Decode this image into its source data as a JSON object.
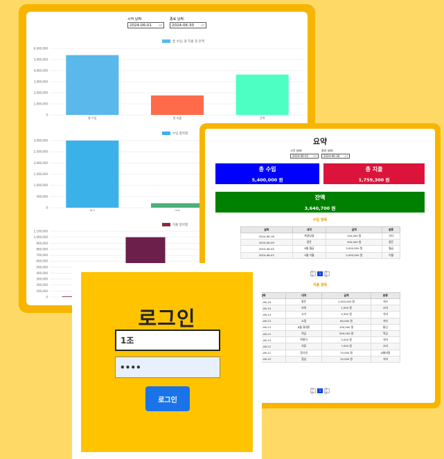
{
  "dashboard": {
    "start_label": "시작 날짜:",
    "end_label": "종료 날짜:",
    "start_date": "2024-06-01",
    "end_date": "2024-06-30",
    "calendar_icon": "calendar-icon"
  },
  "chart_data": [
    {
      "type": "bar",
      "legend": "총 수입, 총 지출 및 잔액",
      "categories": [
        "총 수입",
        "총 지출",
        "잔액"
      ],
      "values": [
        5400000,
        1759300,
        3640700
      ],
      "colors": [
        "#5ab8ea",
        "#ff6b4a",
        "#4dffc3"
      ],
      "y_ticks": [
        "6,000,000",
        "5,000,000",
        "4,000,000",
        "3,000,000",
        "2,000,000",
        "1,000,000",
        "0"
      ],
      "ylim": [
        0,
        6000000
      ],
      "grid": true,
      "legend_position": "top"
    },
    {
      "type": "bar",
      "legend": "수입 항목별",
      "categories": [
        "월급",
        "이자",
        "용돈"
      ],
      "values": [
        3000000,
        200000,
        600000
      ],
      "colors": [
        "#3bb1ea",
        "#4caf7a",
        "#1f6fd8"
      ],
      "y_ticks": [
        "3,000,000",
        "2,500,000",
        "2,000,000",
        "1,500,000",
        "1,000,000",
        "500,000",
        "0"
      ],
      "ylim": [
        0,
        3000000
      ],
      "grid": true,
      "legend_position": "top"
    },
    {
      "type": "bar",
      "legend": "지출 항목별",
      "categories": [
        "식비",
        "",
        "",
        ""
      ],
      "values": [
        10000,
        1000000,
        0,
        0
      ],
      "colors": [
        "#8a2a3a",
        "#6b1f4a",
        "#6b1f4a",
        "#6b1f4a"
      ],
      "y_ticks": [
        "1,100,000",
        "1,000,000",
        "900,000",
        "800,000",
        "700,000",
        "600,000",
        "500,000",
        "400,000",
        "300,000",
        "200,000",
        "100,000",
        "0"
      ],
      "ylim": [
        0,
        1100000
      ],
      "grid": true,
      "legend_position": "top"
    }
  ],
  "summary": {
    "title": "요약",
    "start_label": "시작 날짜:",
    "end_label": "종료 날짜:",
    "start_date": "2024-06-01",
    "end_date": "2024-06-30",
    "income_label": "총 수입",
    "income_value": "5,400,000 원",
    "expense_label": "총 지출",
    "expense_value": "1,759,300 원",
    "balance_label": "잔액",
    "balance_value": "3,640,700 원",
    "colors": {
      "income": "#0000ff",
      "expense": "#dc143c",
      "balance": "#008000"
    },
    "income_section": "수입 항목",
    "income_headers": [
      "날짜",
      "내역",
      "금액",
      "분류"
    ],
    "income_rows": [
      [
        "2024-06-18",
        "복권당첨",
        "100,000 원",
        "기타"
      ],
      [
        "2024-06-09",
        "용돈",
        "300,000 원",
        "용돈"
      ],
      [
        "2024-06-04",
        "6월 월급",
        "3,000,000 원",
        "월급"
      ],
      [
        "2024-06-03",
        "5월 이월",
        "2,000,000 원",
        "이월"
      ]
    ],
    "expense_section": "지출 항목",
    "expense_headers": [
      "날짜",
      "내역",
      "금액",
      "분류"
    ],
    "expense_rows": [
      [
        "2024-06-19",
        "용돈",
        "1,000,000 원",
        "기타"
      ],
      [
        "2024-06-15",
        "커피",
        "1,000 원",
        "소비"
      ],
      [
        "2024-06-14",
        "고기",
        "3,300 원",
        "식비"
      ],
      [
        "2024-06-13",
        "쇼핑",
        "60,000 원",
        "기타"
      ],
      [
        "2024-06-13",
        "6월 휴대폰",
        "100,000 원",
        "통신"
      ],
      [
        "2024-06-12",
        "적금",
        "500,000 원",
        "적금"
      ],
      [
        "2024-06-12",
        "떡볶이",
        "3,000 원",
        "식비"
      ],
      [
        "2024-06-12",
        "의류",
        "7,000 원",
        "소비"
      ],
      [
        "2024-06-11",
        "정기권",
        "75,000 원",
        "교통비용"
      ],
      [
        "2024-06-10",
        "점심",
        "10,000 원",
        "식비"
      ]
    ],
    "pager": [
      "이전",
      "1",
      "다음"
    ]
  },
  "login": {
    "title": "로그인",
    "username_value": "1조",
    "password_value": "••••",
    "button_label": "로그인"
  }
}
